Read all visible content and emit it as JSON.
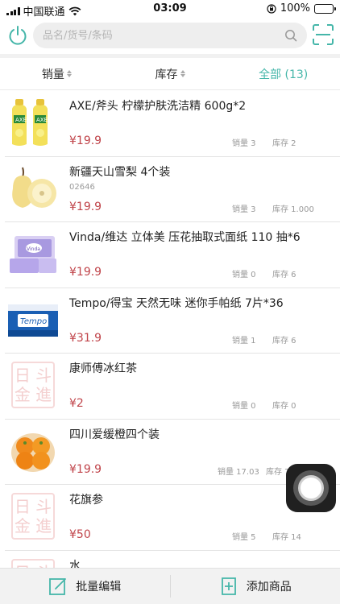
{
  "status_bar": {
    "carrier": "中国联通",
    "time": "03:09",
    "battery": "100%",
    "battery_level": 1.0
  },
  "search": {
    "placeholder": "品名/货号/条码"
  },
  "sort_tabs": [
    {
      "label": "销量"
    },
    {
      "label": "库存"
    },
    {
      "label": "全部 (13)"
    }
  ],
  "products": [
    {
      "name": "AXE/斧头 柠檬护肤洗洁精 600g*2",
      "code": "",
      "price": "¥19.9",
      "sales": "销量 3",
      "stock": "库存 2",
      "image": "dish-soap-bottles"
    },
    {
      "name": "新疆天山雪梨 4个装",
      "code": "02646",
      "price": "¥19.9",
      "sales": "销量 3",
      "stock": "库存 1.000",
      "image": "snow-pears"
    },
    {
      "name": "Vinda/维达 立体美 压花抽取式面纸 110 抽*6",
      "code": "",
      "price": "¥19.9",
      "sales": "销量 0",
      "stock": "库存 6",
      "image": "tissue-pack"
    },
    {
      "name": "Tempo/得宝 天然无味 迷你手帕纸 7片*36",
      "code": "",
      "price": "¥31.9",
      "sales": "销量 1",
      "stock": "库存 6",
      "image": "handkerchief-pack"
    },
    {
      "name": "康师傅冰红茶",
      "code": "",
      "price": "¥2",
      "sales": "销量 0",
      "stock": "库存 0",
      "image": "placeholder-logo"
    },
    {
      "name": "四川爱缓橙四个装",
      "code": "",
      "price": "¥19.9",
      "sales": "销量 17.03",
      "stock": "库存 7",
      "image": "oranges"
    },
    {
      "name": "花旗参",
      "code": "",
      "price": "¥50",
      "sales": "销量 5",
      "stock": "库存 14",
      "image": "placeholder-logo"
    },
    {
      "name": "水",
      "code": "",
      "price": "",
      "sales": "",
      "stock": "",
      "image": "placeholder-logo"
    }
  ],
  "placeholder_logo": {
    "top": "日 斗",
    "bottom": "金 進"
  },
  "bottom_bar": {
    "batch_edit": "批量编辑",
    "add_product": "添加商品"
  },
  "colors": {
    "accent": "#45b6a9",
    "price": "#c0444a"
  }
}
